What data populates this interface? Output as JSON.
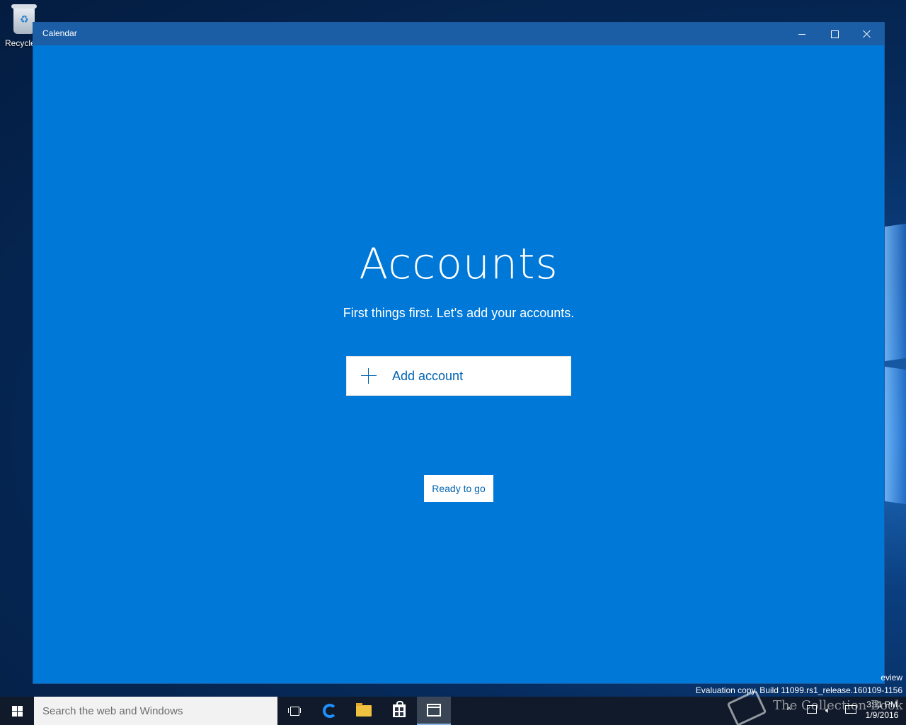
{
  "desktop": {
    "recycle_bin_label": "Recycle",
    "evaluation_line1": "eview",
    "evaluation_line2": "Evaluation copy. Build 11099.rs1_release.160109-1156"
  },
  "window": {
    "title": "Calendar",
    "heading": "Accounts",
    "subtitle": "First things first. Let's add your accounts.",
    "add_account_label": "Add account",
    "ready_label": "Ready to go",
    "accent_color": "#0078d7"
  },
  "taskbar": {
    "search_placeholder": "Search the web and Windows",
    "pinned": [
      "task-view",
      "edge",
      "file-explorer",
      "store",
      "calendar"
    ],
    "active_app": "calendar",
    "tray": {
      "time": "3:11 PM",
      "date": "1/9/2016"
    }
  },
  "watermark": {
    "text": "The Collection Book"
  }
}
